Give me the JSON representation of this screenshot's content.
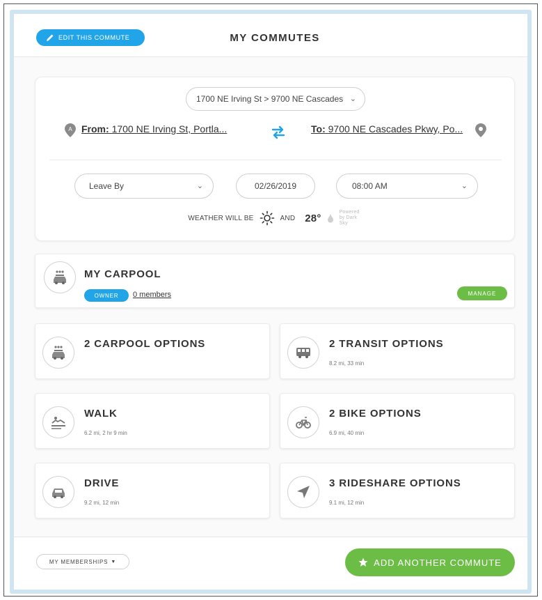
{
  "header": {
    "edit_label": "EDIT THIS COMMUTE",
    "title": "MY COMMUTES"
  },
  "route": {
    "selected": "1700 NE Irving St > 9700 NE Cascades",
    "from_label": "From:",
    "from_value": "1700 NE Irving St, Portla...",
    "to_label": "To:",
    "to_value": "9700 NE Cascades Pkwy, Po...",
    "from_pin_letter": "A"
  },
  "trip": {
    "leave_by": "Leave By",
    "date": "02/26/2019",
    "time": "08:00 AM"
  },
  "weather": {
    "prefix": "WEATHER WILL BE",
    "and": "AND",
    "temp": "28°",
    "powered": "Powered by Dark Sky"
  },
  "carpool": {
    "title": "MY CARPOOL",
    "owner_badge": "OWNER",
    "members": "0 members",
    "manage": "MANAGE"
  },
  "options": [
    {
      "title": "2 CARPOOL OPTIONS",
      "sub": "",
      "icon": "carpool-icon"
    },
    {
      "title": "2 TRANSIT OPTIONS",
      "sub": "8.2 mi, 33 min",
      "icon": "bus-icon"
    },
    {
      "title": "WALK",
      "sub": "6.2 mi, 2 hr 9 min",
      "icon": "walk-icon"
    },
    {
      "title": "2 BIKE OPTIONS",
      "sub": "6.9 mi, 40 min",
      "icon": "bike-icon"
    },
    {
      "title": "DRIVE",
      "sub": "9.2 mi, 12 min",
      "icon": "car-icon"
    },
    {
      "title": "3 RIDESHARE OPTIONS",
      "sub": "9.1 mi, 12 min",
      "icon": "navigation-arrow-icon"
    }
  ],
  "footer": {
    "memberships": "MY MEMBERSHIPS",
    "add_commute": "ADD ANOTHER COMMUTE"
  },
  "colors": {
    "blue": "#22a4e9",
    "green": "#6cbd45",
    "frame": "#cfe6f2"
  }
}
